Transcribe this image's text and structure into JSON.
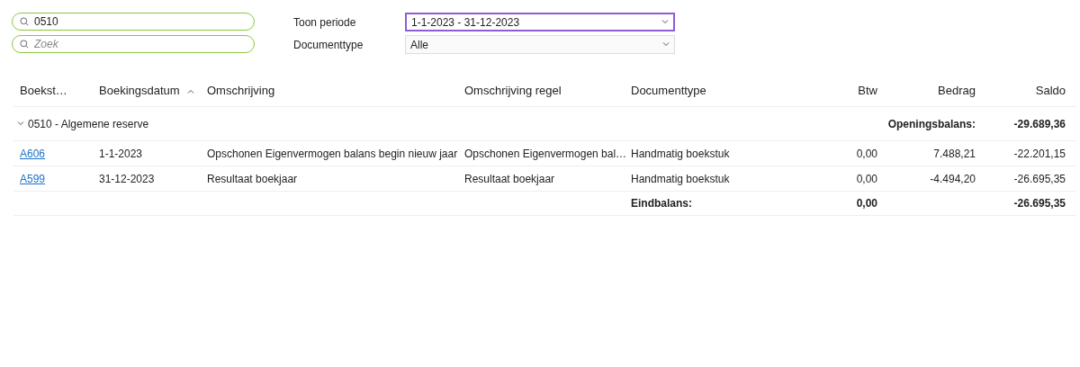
{
  "search_fields": [
    {
      "value": "0510"
    },
    {
      "placeholder": "Zoek"
    }
  ],
  "filters": [
    {
      "label": "Toon periode",
      "value": "1-1-2023 - 31-12-2023",
      "focused": true
    },
    {
      "label": "Documenttype",
      "value": "Alle",
      "focused": false
    }
  ],
  "table": {
    "columns": [
      {
        "label": "Boekst…",
        "sorted": false
      },
      {
        "label": "Boekingsdatum",
        "sorted": true
      },
      {
        "label": "Omschrijving",
        "sorted": false
      },
      {
        "label": "Omschrijving regel",
        "sorted": false
      },
      {
        "label": "Documenttype",
        "sorted": false
      },
      {
        "label": "Btw",
        "sorted": false
      },
      {
        "label": "Bedrag",
        "sorted": false
      },
      {
        "label": "Saldo",
        "sorted": false
      }
    ],
    "group": {
      "title": "0510 - Algemene reserve",
      "expanded": true,
      "opening_label": "Openingsbalans:",
      "opening_value": "-29.689,36"
    },
    "rows": [
      {
        "cells": [
          "A606",
          "1-1-2023",
          "Opschonen Eigenvermogen balans begin nieuw jaar",
          "Opschonen Eigenvermogen bal…",
          "Handmatig boekstuk",
          "0,00",
          "7.488,21",
          "-22.201,15"
        ]
      },
      {
        "cells": [
          "A599",
          "31-12-2023",
          "Resultaat boekjaar",
          "Resultaat boekjaar",
          "Handmatig boekstuk",
          "0,00",
          "-4.494,20",
          "-26.695,35"
        ]
      }
    ],
    "footer": {
      "label": "Eindbalans:",
      "btw": "0,00",
      "saldo": "-26.695,35"
    }
  }
}
